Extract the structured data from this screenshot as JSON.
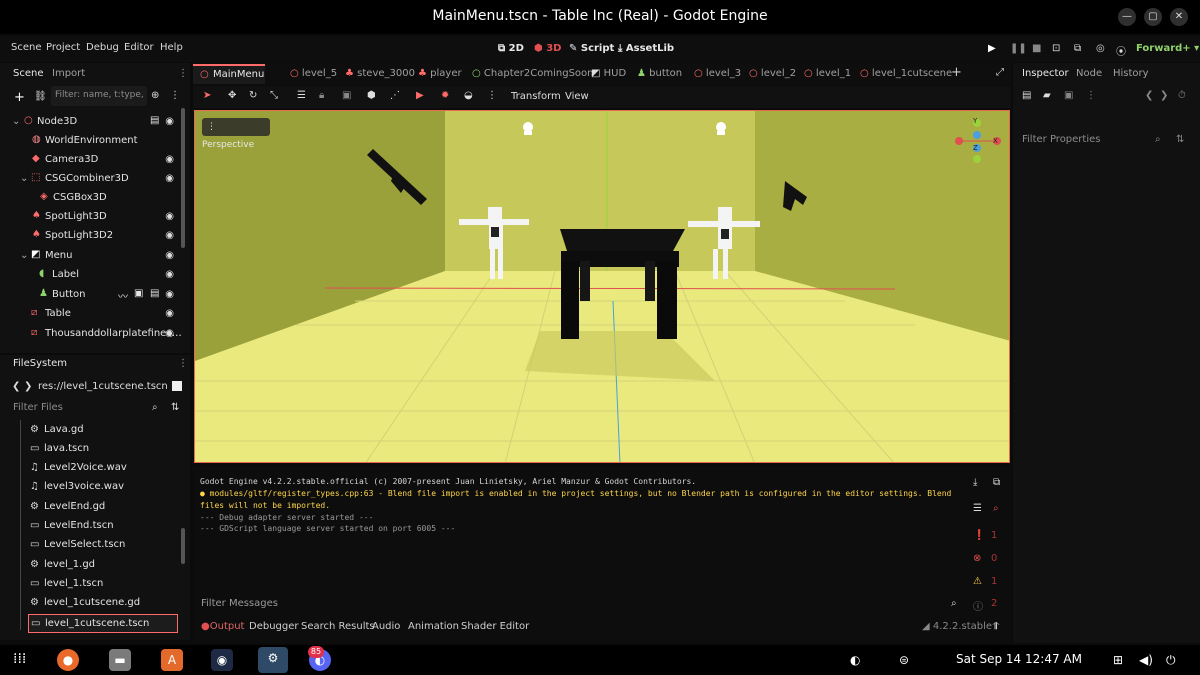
{
  "window": {
    "title": "MainMenu.tscn - Table Inc (Real) - Godot Engine"
  },
  "menu": [
    "Scene",
    "Project",
    "Debug",
    "Editor",
    "Help"
  ],
  "modes": {
    "m2d": "2D",
    "m3d": "3D",
    "script": "Script",
    "assetlib": "AssetLib"
  },
  "renderer": "Forward+",
  "scene_dock": {
    "tabs": [
      "Scene",
      "Import"
    ],
    "filter_placeholder": "Filter: name, t:type, g:",
    "tree": [
      {
        "label": "Node3D",
        "icon": "node3d-icon"
      },
      {
        "label": "WorldEnvironment",
        "icon": "world-environment-icon"
      },
      {
        "label": "Camera3D",
        "icon": "camera-icon"
      },
      {
        "label": "CSGCombiner3D",
        "icon": "csg-combiner-icon"
      },
      {
        "label": "CSGBox3D",
        "icon": "csg-box-icon"
      },
      {
        "label": "SpotLight3D",
        "icon": "spotlight-icon"
      },
      {
        "label": "SpotLight3D2",
        "icon": "spotlight-icon"
      },
      {
        "label": "Menu",
        "icon": "control-icon"
      },
      {
        "label": "Label",
        "icon": "label-icon"
      },
      {
        "label": "Button",
        "icon": "button-icon"
      },
      {
        "label": "Table",
        "icon": "scene-icon"
      },
      {
        "label": "Thousanddollarplatefinec…",
        "icon": "scene-icon"
      }
    ]
  },
  "filesystem": {
    "title": "FileSystem",
    "path": "res://level_1cutscene.tscn",
    "filter_placeholder": "Filter Files",
    "files": [
      {
        "name": "Lava.gd",
        "icon": "gear-icon"
      },
      {
        "name": "lava.tscn",
        "icon": "clapper-icon"
      },
      {
        "name": "Level2Voice.wav",
        "icon": "audio-icon"
      },
      {
        "name": "level3voice.wav",
        "icon": "audio-icon"
      },
      {
        "name": "LevelEnd.gd",
        "icon": "gear-icon"
      },
      {
        "name": "LevelEnd.tscn",
        "icon": "clapper-icon"
      },
      {
        "name": "LevelSelect.tscn",
        "icon": "clapper-icon"
      },
      {
        "name": "level_1.gd",
        "icon": "gear-icon"
      },
      {
        "name": "level_1.tscn",
        "icon": "clapper-icon"
      },
      {
        "name": "level_1cutscene.gd",
        "icon": "gear-icon"
      },
      {
        "name": "level_1cutscene.tscn",
        "icon": "clapper-icon"
      }
    ]
  },
  "scene_tabs": [
    "MainMenu",
    "level_5",
    "steve_3000",
    "player",
    "Chapter2ComingSoon",
    "HUD",
    "button",
    "level_3",
    "level_2",
    "level_1",
    "level_1cutscene"
  ],
  "viewport_toolbar": {
    "transform": "Transform",
    "view": "View",
    "perspective": "Perspective"
  },
  "inspector": {
    "tabs": [
      "Inspector",
      "Node",
      "History"
    ],
    "filter_placeholder": "Filter Properties"
  },
  "output": {
    "line1": "Godot Engine v4.2.2.stable.official (c) 2007-present Juan Linietsky, Ariel Manzur & Godot Contributors.",
    "line2": "modules/gltf/register_types.cpp:63 - Blend file import is enabled in the project settings, but no Blender path is configured in the editor settings. Blend",
    "line3": "files will not be imported.",
    "line4": "--- Debug adapter server started ---",
    "line5": "--- GDScript language server started on port 6005 ---",
    "filter_placeholder": "Filter Messages",
    "counts": {
      "errors": "1",
      "warnings_a": "0",
      "warnings_b": "1",
      "info": "2"
    }
  },
  "bottom_tabs": [
    "Output",
    "Debugger",
    "Search Results",
    "Audio",
    "Animation",
    "Shader Editor"
  ],
  "version": "4.2.2.stable",
  "taskbar": {
    "clock": "Sat Sep 14  12:47 AM",
    "badge": "85"
  },
  "colors": {
    "viewport_floor": "#e8e87a",
    "viewport_wall": "#b5b94c",
    "accent": "#ff6a6a"
  }
}
